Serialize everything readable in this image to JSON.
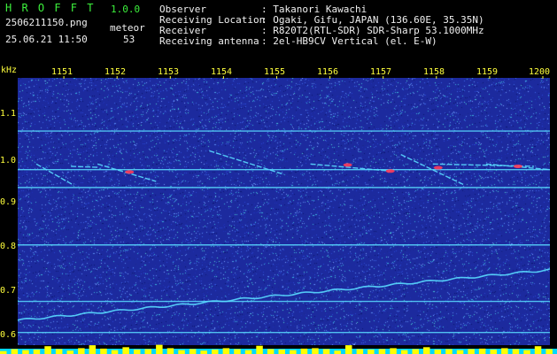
{
  "header": {
    "app_title": "H R O F F T",
    "version": "1.0.0",
    "filename": "2506211150.png",
    "detection_label": "meteor",
    "timestamp": "25.06.21 11:50",
    "detection_count": "53",
    "info_labels": [
      "Observer",
      "Receiving Location",
      "Receiver",
      "Receiving antenna"
    ],
    "info_values": [
      ": Takanori Kawachi",
      ": Ogaki, Gifu, JAPAN (136.60E, 35.35N)",
      ": R820T2(RTL-SDR) SDR-Sharp 53.1000MHz",
      ": 2el-HB9CV Vertical (el. E-W)"
    ]
  },
  "colors": {
    "background": "#000000",
    "label_yellow": "#ffff3c",
    "title_green": "#3cf03c",
    "text_white": "#f0f0f0",
    "spectrogram_base": "#1c2a9e",
    "signal_cyan": "#5adcff",
    "meteor_red": "#ff3c5a",
    "power_bar": "#ffff00"
  },
  "chart_data": {
    "type": "heatmap",
    "xlabel": "",
    "ylabel": "kHz",
    "x_ticks": [
      "1151",
      "1152",
      "1153",
      "1154",
      "1155",
      "1156",
      "1157",
      "1158",
      "1159",
      "1200"
    ],
    "y_ticks": [
      "1.1",
      "1.0",
      "0.9",
      "0.8",
      "0.7",
      "0.6"
    ],
    "ylim": [
      0.595,
      1.163
    ],
    "x_range_minutes": [
      0,
      10
    ],
    "horizontal_carriers_khz": [
      1.05,
      0.968,
      0.93,
      0.808,
      0.688,
      0.622
    ],
    "drifting_carrier": {
      "from": [
        0,
        0.648
      ],
      "to": [
        10,
        0.755
      ]
    },
    "meteor_echo_segments": [
      [
        [
          0.35,
          0.98
        ],
        [
          1.05,
          0.935
        ]
      ],
      [
        [
          1.0,
          0.975
        ],
        [
          1.5,
          0.973
        ]
      ],
      [
        [
          1.5,
          0.98
        ],
        [
          2.6,
          0.943
        ]
      ],
      [
        [
          3.6,
          1.008
        ],
        [
          5.0,
          0.958
        ]
      ],
      [
        [
          5.5,
          0.98
        ],
        [
          7.0,
          0.965
        ]
      ],
      [
        [
          7.2,
          1.0
        ],
        [
          8.4,
          0.935
        ]
      ],
      [
        [
          7.8,
          0.98
        ],
        [
          9.7,
          0.975
        ]
      ],
      [
        [
          8.8,
          0.98
        ],
        [
          10.0,
          0.968
        ]
      ]
    ],
    "meteor_heads": [
      [
        2.1,
        0.963
      ],
      [
        6.2,
        0.978
      ],
      [
        7.0,
        0.965
      ],
      [
        7.9,
        0.972
      ],
      [
        9.4,
        0.975
      ]
    ],
    "power_series_values": [
      0.3,
      0.5,
      0.4,
      0.45,
      0.8,
      0.5,
      0.35,
      0.6,
      0.9,
      0.55,
      0.4,
      0.7,
      0.45,
      0.5,
      0.95,
      0.6,
      0.4,
      0.5,
      0.35,
      0.45,
      0.6,
      0.5,
      0.4,
      0.85,
      0.5,
      0.45,
      0.4,
      0.55,
      0.6,
      0.5,
      0.35,
      0.9,
      0.5,
      0.45,
      0.5,
      0.6,
      0.4,
      0.5,
      0.7,
      0.45,
      0.5,
      0.4,
      0.5,
      0.55,
      0.45,
      0.6,
      0.5,
      0.4,
      0.8,
      0.5
    ]
  }
}
